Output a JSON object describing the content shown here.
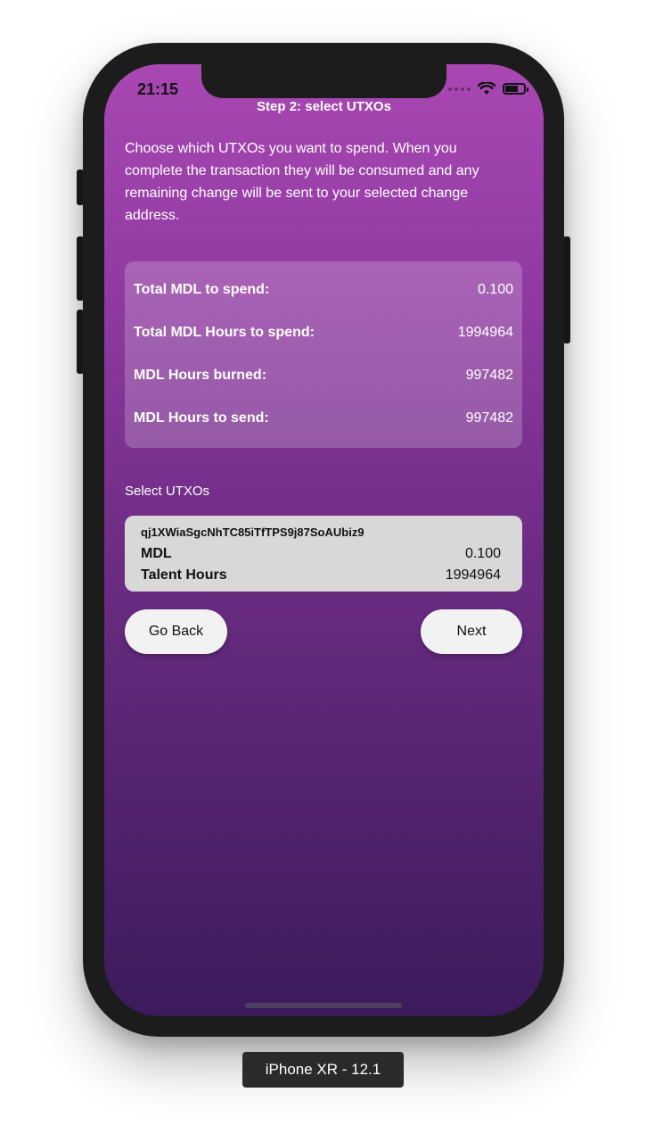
{
  "status_bar": {
    "time": "21:15"
  },
  "header": {
    "title": "Step 2: select UTXOs"
  },
  "intro_text": "Choose which UTXOs you want to spend. When you complete the transaction they will be consumed and any remaining change will be sent to your selected change address.",
  "summary": {
    "rows": [
      {
        "label": "Total MDL to spend:",
        "value": "0.100"
      },
      {
        "label": "Total MDL Hours to spend:",
        "value": "1994964"
      },
      {
        "label": "MDL Hours burned:",
        "value": "997482"
      },
      {
        "label": "MDL Hours to send:",
        "value": "997482"
      }
    ]
  },
  "utxo_section": {
    "label": "Select UTXOs",
    "items": [
      {
        "hash": "qj1XWiaSgcNhTC85iTfTPS9j87SoAUbiz9",
        "mdl_label": "MDL",
        "mdl_value": "0.100",
        "hours_label": "Talent Hours",
        "hours_value": "1994964"
      }
    ]
  },
  "buttons": {
    "back": "Go Back",
    "next": "Next"
  },
  "device_label": "iPhone XR - 12.1",
  "colors": {
    "gradient_top": "#a947b3",
    "gradient_bottom": "#3c1b5c",
    "card_bg": "#d8d8d8",
    "button_bg": "#f2f2f2"
  }
}
